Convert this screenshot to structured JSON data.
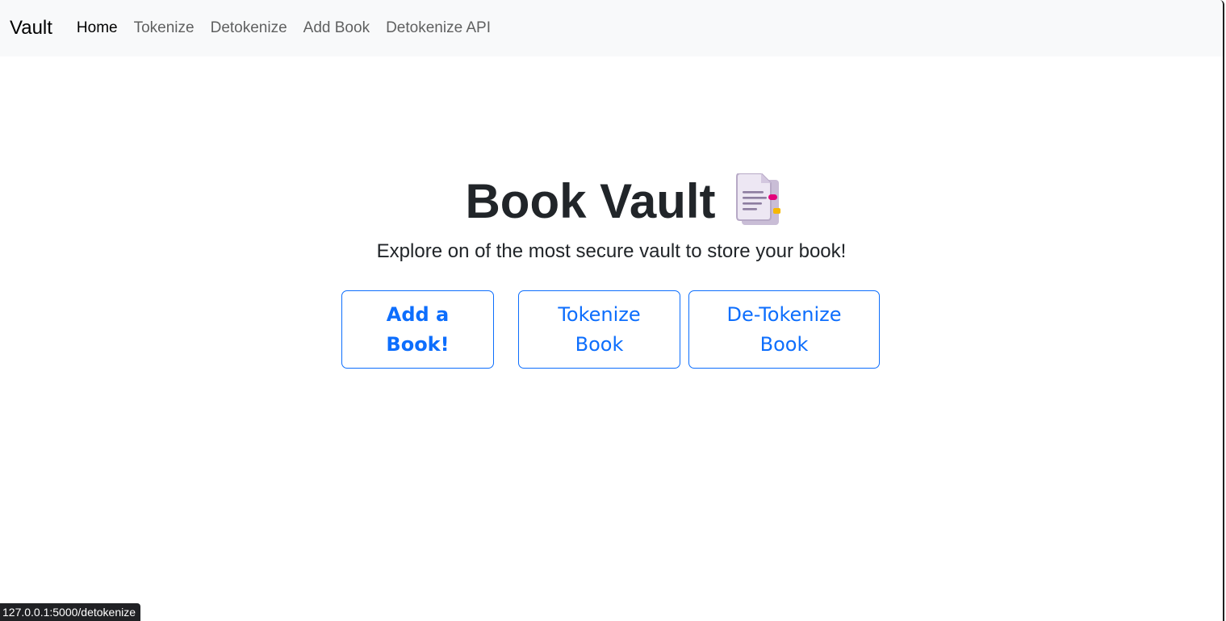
{
  "navbar": {
    "brand": "Vault",
    "links": [
      {
        "label": "Home",
        "active": true
      },
      {
        "label": "Tokenize",
        "active": false
      },
      {
        "label": "Detokenize",
        "active": false
      },
      {
        "label": "Add Book",
        "active": false
      },
      {
        "label": "Detokenize API",
        "active": false
      }
    ]
  },
  "hero": {
    "title": "Book Vault",
    "icon": "bookmark-tabs-icon",
    "subtitle": "Explore on of the most secure vault to store your book!"
  },
  "buttons": {
    "add_book": {
      "line1": "Add a",
      "line2": "Book!"
    },
    "tokenize": {
      "line1": "Tokenize",
      "line2": "Book"
    },
    "detokenize": {
      "line1": "De-Tokenize",
      "line2": "Book"
    }
  },
  "status_bar": {
    "url": "127.0.0.1:5000/detokenize"
  },
  "colors": {
    "primary": "#0d6efd",
    "navbar_bg": "#f8f9fa",
    "text_dark": "#212529"
  }
}
